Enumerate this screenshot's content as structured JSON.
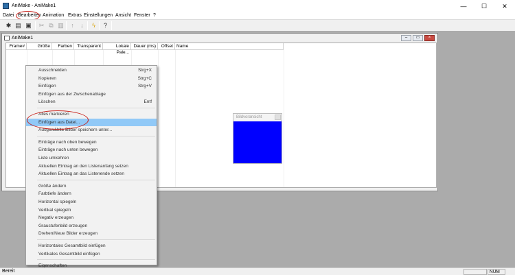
{
  "window": {
    "title": "AniMake - AniMake1",
    "minimize": "—",
    "maximize": "☐",
    "close": "✕"
  },
  "menubar": [
    "Datei",
    "Bearbeiten",
    "Animation",
    "Extras",
    "Einstellungen",
    "Ansicht",
    "Fenster",
    "?"
  ],
  "child": {
    "title": "AniMake1",
    "columns": [
      "Frame#",
      "Größe",
      "Farben",
      "Transparent",
      "Lokale Pale...",
      "Dauer (ms)",
      "Offset",
      "Name"
    ]
  },
  "context_menu": {
    "groups": [
      [
        {
          "label": "Ausschneiden",
          "shortcut": "Strg+X"
        },
        {
          "label": "Kopieren",
          "shortcut": "Strg+C"
        },
        {
          "label": "Einfügen",
          "shortcut": "Strg+V"
        },
        {
          "label": "Einfügen aus der Zwischenablage",
          "shortcut": ""
        },
        {
          "label": "Löschen",
          "shortcut": "Entf"
        }
      ],
      [
        {
          "label": "Alles markieren",
          "shortcut": ""
        },
        {
          "label": "Einfügen aus Datei...",
          "shortcut": "",
          "selected": true
        },
        {
          "label": "Ausgewählte Bilder speichern unter...",
          "shortcut": ""
        }
      ],
      [
        {
          "label": "Einträge nach oben bewegen",
          "shortcut": ""
        },
        {
          "label": "Einträge nach unten bewegen",
          "shortcut": ""
        },
        {
          "label": "Liste umkehren",
          "shortcut": ""
        },
        {
          "label": "Aktuellen Eintrag an den Listenanfang setzen",
          "shortcut": ""
        },
        {
          "label": "Aktuellen Eintrag an das Listenende setzen",
          "shortcut": ""
        }
      ],
      [
        {
          "label": "Größe ändern",
          "shortcut": ""
        },
        {
          "label": "Farbtiefe ändern",
          "shortcut": ""
        },
        {
          "label": "Horizontal spiegeln",
          "shortcut": ""
        },
        {
          "label": "Vertikal spiegeln",
          "shortcut": ""
        },
        {
          "label": "Negativ erzeugen",
          "shortcut": ""
        },
        {
          "label": "Graustufenbild erzeugen",
          "shortcut": ""
        },
        {
          "label": "Drehen/Neue Bilder erzeugen",
          "shortcut": ""
        }
      ],
      [
        {
          "label": "Horizontales Gesamtbild einfügen",
          "shortcut": ""
        },
        {
          "label": "Vertikales Gesamtbild einfügen",
          "shortcut": ""
        }
      ],
      [
        {
          "label": "Eigenschaften",
          "shortcut": ""
        }
      ]
    ]
  },
  "preview": {
    "title": "Bildvoransicht",
    "fill_color": "#0000ff"
  },
  "statusbar": {
    "text": "Bereit",
    "num": "NUM"
  },
  "toolbar_icons": [
    "new-icon",
    "open-icon",
    "save-icon",
    "cut-icon",
    "copy-icon",
    "paste-icon",
    "move-up-icon",
    "move-down-icon",
    "play-icon",
    "help-icon"
  ],
  "colors": {
    "highlight": "#91c9f7",
    "annotation": "#c8201a"
  }
}
